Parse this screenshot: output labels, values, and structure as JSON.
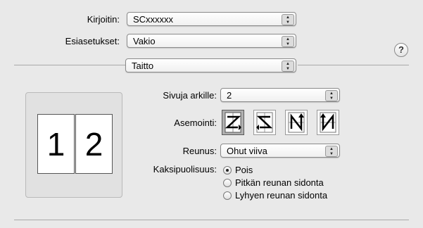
{
  "printer": {
    "label": "Kirjoitin:",
    "value": "SCxxxxxx"
  },
  "presets": {
    "label": "Esiasetukset:",
    "value": "Vakio"
  },
  "panel": {
    "value": "Taitto"
  },
  "help": {
    "glyph": "?"
  },
  "preview": {
    "pages": [
      "1",
      "2"
    ]
  },
  "pages_per_sheet": {
    "label": "Sivuja arkille:",
    "value": "2"
  },
  "layout_direction": {
    "label": "Asemointi:",
    "options": [
      {
        "icon": "z-left-to-right-icon",
        "selected": true
      },
      {
        "icon": "s-reverse-icon",
        "selected": false
      },
      {
        "icon": "n-down-icon",
        "selected": false
      },
      {
        "icon": "n-reverse-icon",
        "selected": false
      }
    ]
  },
  "border": {
    "label": "Reunus:",
    "value": "Ohut viiva"
  },
  "two_sided": {
    "label": "Kaksipuolisuus:",
    "options": [
      {
        "label": "Pois",
        "checked": true
      },
      {
        "label": "Pitkän reunan sidonta",
        "checked": false
      },
      {
        "label": "Lyhyen reunan sidonta",
        "checked": false
      }
    ]
  }
}
